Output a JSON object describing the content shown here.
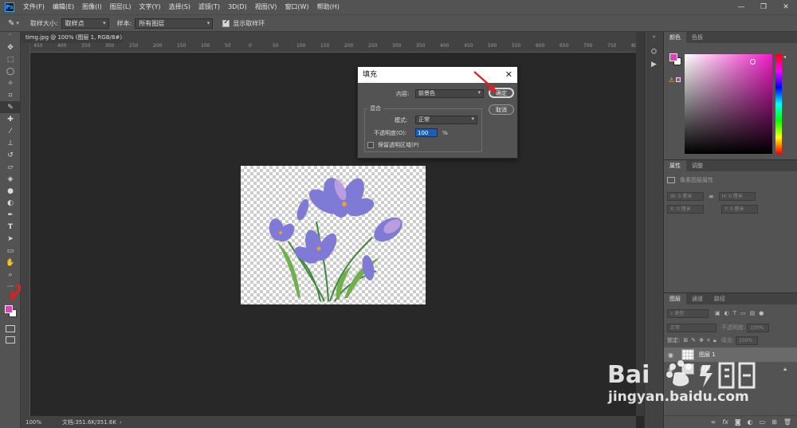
{
  "menubar": {
    "logo": "Ps",
    "items": [
      "文件(F)",
      "编辑(E)",
      "图像(I)",
      "图层(L)",
      "文字(Y)",
      "选择(S)",
      "滤镜(T)",
      "3D(D)",
      "视图(V)",
      "窗口(W)",
      "帮助(H)"
    ],
    "win_min": "—",
    "win_max": "❐",
    "win_close": "✕"
  },
  "options": {
    "sample_size_label": "取样大小:",
    "sample_size_value": "取样点",
    "sample_label": "样本:",
    "sample_value": "所有图层",
    "show_ring_label": "显示取样环"
  },
  "document": {
    "tab_title": "timg.jpg @ 100% (图层 1, RGB/8#) *",
    "tab_close": "×",
    "ruler_h": [
      "450",
      "400",
      "350",
      "300",
      "250",
      "200",
      "150",
      "100",
      "50",
      "0",
      "50",
      "100",
      "150",
      "200",
      "250",
      "300",
      "350",
      "400",
      "450",
      "500",
      "550",
      "600",
      "650",
      "700",
      "750",
      "800"
    ],
    "zoom": "100%",
    "doc_size": "文档:351.6K/351.6K"
  },
  "dialog": {
    "title": "填充",
    "close": "✕",
    "content_label": "内容:",
    "content_value": "前景色",
    "blend_group": "混合",
    "mode_label": "模式:",
    "mode_value": "正常",
    "opacity_label": "不透明度(O):",
    "opacity_value": "100",
    "opacity_unit": "%",
    "preserve_label": "保留透明区域(P)",
    "ok": "确定",
    "cancel": "取消"
  },
  "panels": {
    "color_tab": "颜色",
    "swatches_tab": "色板",
    "props_tab": "属性",
    "adjust_tab": "调整",
    "props_type": "像素图层属性",
    "w_label": "W:",
    "w_value": "0 厘米",
    "h_label": "H:",
    "h_value": "0 厘米",
    "x_label": "X:",
    "x_value": "0 厘米",
    "y_label": "Y:",
    "y_value": "0 厘米",
    "layers_tab": "图层",
    "channels_tab": "通道",
    "paths_tab": "路径",
    "kind_placeholder": "类型",
    "blend_value": "正常",
    "opacity_label": "不透明度:",
    "opacity_value": "100%",
    "lock_label": "锁定:",
    "fill_label": "填充:",
    "fill_value": "100%",
    "layer1": "图层 1",
    "layer2": "背景"
  },
  "colors": {
    "foreground": "#e040b8",
    "background": "#ffffff"
  },
  "watermark": {
    "text": "jingyan.baidu.com"
  }
}
